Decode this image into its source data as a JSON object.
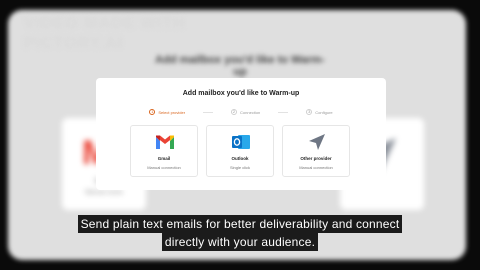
{
  "watermark": {
    "line1": "VIDEO MADE WITH",
    "line2": "PICTORY.AI"
  },
  "modal": {
    "title": "Add mailbox you'd like to Warm-up",
    "steps": [
      {
        "number": "1",
        "label": "Select provider",
        "active": true
      },
      {
        "number": "2",
        "label": "Connection",
        "active": false
      },
      {
        "number": "3",
        "label": "Configure",
        "active": false
      }
    ],
    "providers": [
      {
        "name": "Gmail",
        "description": "Manual connection",
        "icon": "gmail-icon"
      },
      {
        "name": "Outlook",
        "description": "Single click",
        "icon": "outlook-icon"
      },
      {
        "name": "Other provider",
        "description": "Manual connection",
        "icon": "paper-plane-icon"
      }
    ]
  },
  "background": {
    "gmail_caption": "Gmail",
    "gmail_sub": "Manual conne"
  },
  "caption": {
    "line1": "Send plain text emails for better deliverability and connect",
    "line2": "directly with your audience."
  },
  "colors": {
    "accent": "#d9641c",
    "gmail_red": "#ea4335",
    "gmail_blue": "#4285f4",
    "gmail_green": "#34a853",
    "gmail_yellow": "#fbbc04",
    "outlook_blue": "#0a72c6",
    "plane_gray": "#6e7684"
  }
}
